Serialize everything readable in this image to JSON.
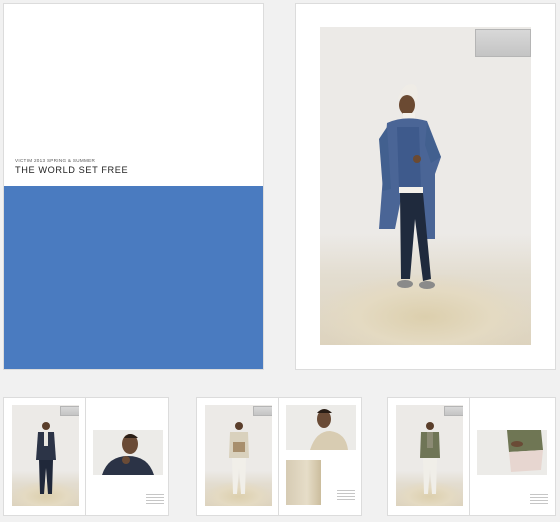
{
  "colors": {
    "page_bg": "#f1f1f1",
    "accent_blue": "#4a7bc0",
    "card_border": "#dcdcdc"
  },
  "cover": {
    "season": "VICTIM 2013 SPRING & SUMMER",
    "title": "THE WORLD SET FREE"
  }
}
